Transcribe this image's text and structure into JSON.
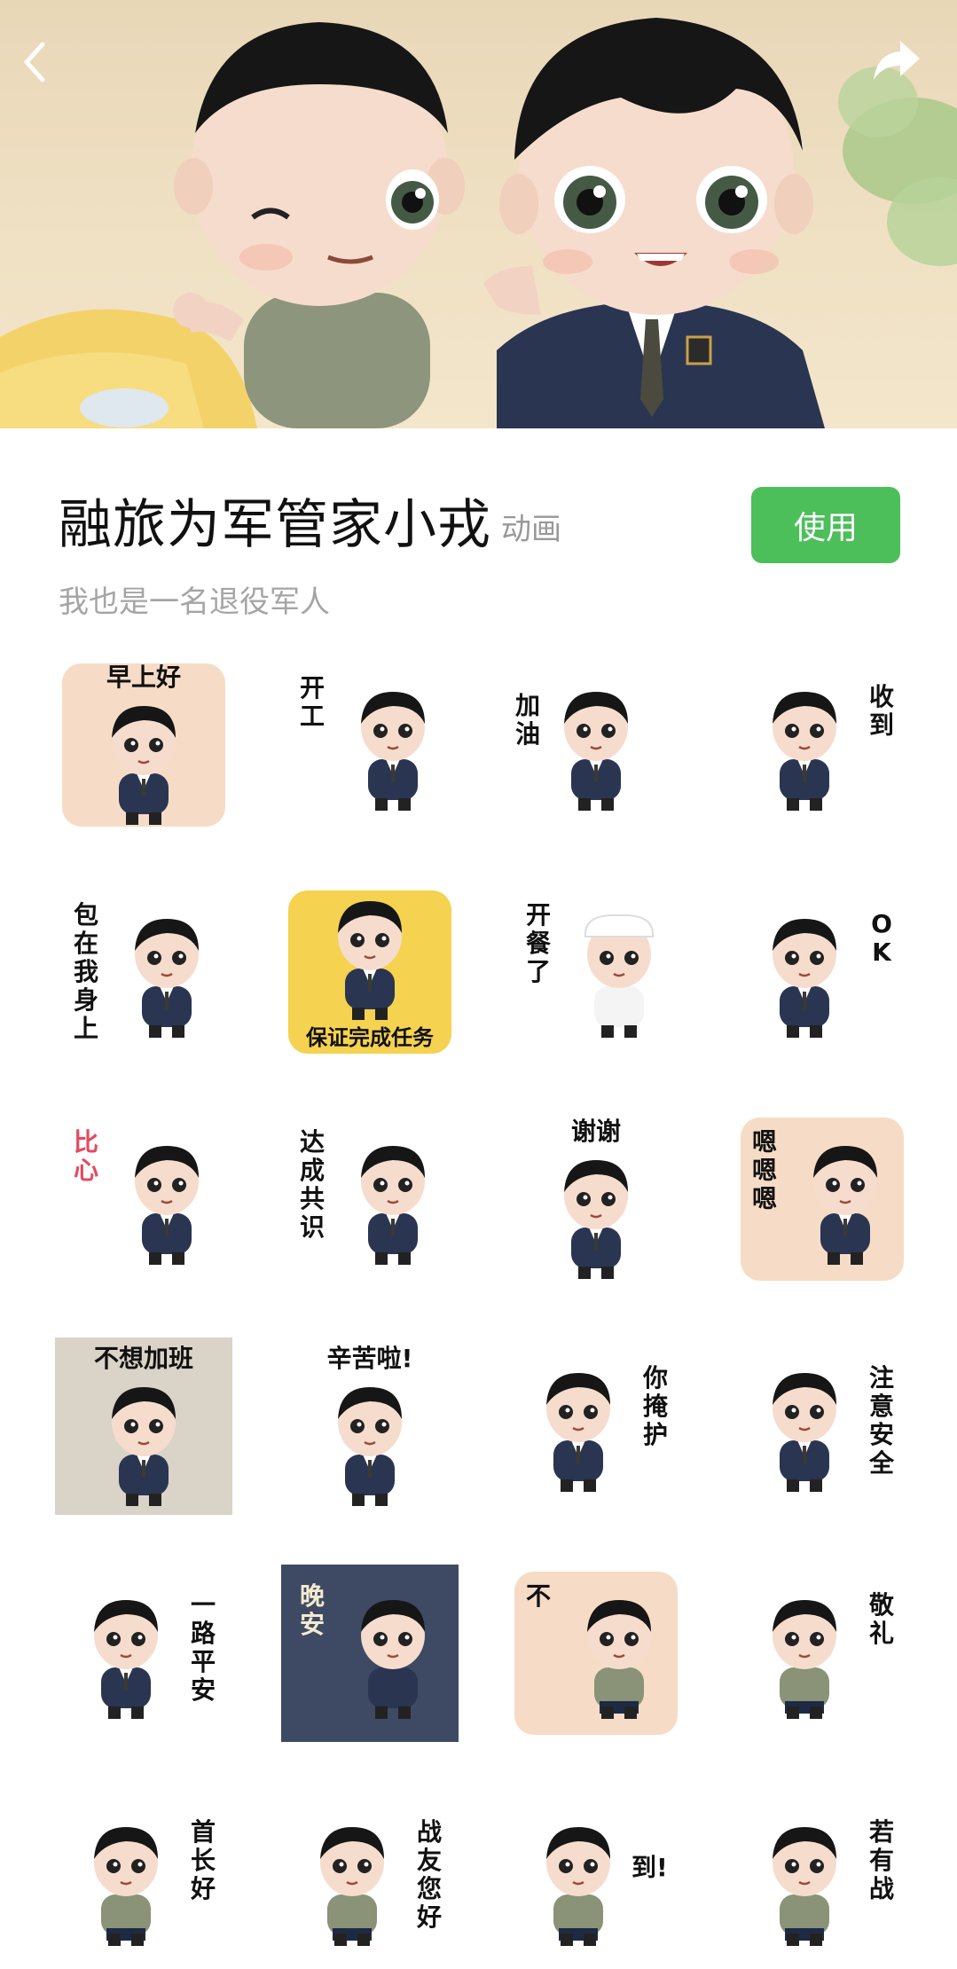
{
  "header": {
    "back_icon": "back-chevron-icon",
    "share_icon": "share-forward-icon"
  },
  "pack": {
    "title": "融旅为军管家小戎",
    "tag": "动画",
    "subtitle": "我也是一名退役军人",
    "use_label": "使用"
  },
  "stickers": [
    {
      "caption": "早上好",
      "outfit": "suit",
      "bg": "peach",
      "cap": "top"
    },
    {
      "caption": "开工",
      "outfit": "suit",
      "bg": "none",
      "cap": "vleft"
    },
    {
      "caption": "加油",
      "outfit": "suit",
      "bg": "none",
      "cap": "split"
    },
    {
      "caption": "收到",
      "outfit": "suit",
      "bg": "none",
      "cap": "vright"
    },
    {
      "caption": "包在我身上",
      "outfit": "suit",
      "bg": "none",
      "cap": "vleft"
    },
    {
      "caption": "保证完成任务",
      "outfit": "suit",
      "bg": "yellow",
      "cap": "bottom"
    },
    {
      "caption": "开餐了",
      "outfit": "chef",
      "bg": "none",
      "cap": "vleft"
    },
    {
      "caption": "OK",
      "outfit": "suit",
      "bg": "none",
      "cap": "vright"
    },
    {
      "caption": "比心",
      "outfit": "suit",
      "bg": "none",
      "cap": "vleft-red"
    },
    {
      "caption": "达成共识",
      "outfit": "suit",
      "bg": "none",
      "cap": "vleft"
    },
    {
      "caption": "谢谢",
      "outfit": "suit",
      "bg": "none",
      "cap": "top"
    },
    {
      "caption": "嗯嗯嗯",
      "outfit": "suit",
      "bg": "peach",
      "cap": "vleft"
    },
    {
      "caption": "不想加班",
      "outfit": "suit",
      "bg": "office",
      "cap": "top"
    },
    {
      "caption": "辛苦啦!",
      "outfit": "suit",
      "bg": "none",
      "cap": "top"
    },
    {
      "caption": "你掩护",
      "outfit": "suit",
      "bg": "none",
      "cap": "vright"
    },
    {
      "caption": "注意安全",
      "outfit": "suit",
      "bg": "none",
      "cap": "vright"
    },
    {
      "caption": "一路平安",
      "outfit": "suit",
      "bg": "none",
      "cap": "vright"
    },
    {
      "caption": "晚安",
      "outfit": "sleep",
      "bg": "night",
      "cap": "vleft-light"
    },
    {
      "caption": "不",
      "outfit": "tshirt",
      "bg": "peach",
      "cap": "vleft"
    },
    {
      "caption": "敬礼",
      "outfit": "tshirt",
      "bg": "none",
      "cap": "vright"
    },
    {
      "caption": "首长好",
      "outfit": "tshirt",
      "bg": "none",
      "cap": "vright"
    },
    {
      "caption": "战友您好",
      "outfit": "tshirt",
      "bg": "none",
      "cap": "vright"
    },
    {
      "caption": "到!",
      "outfit": "tshirt",
      "bg": "none",
      "cap": "right"
    },
    {
      "caption": "若有战",
      "outfit": "tshirt",
      "bg": "none",
      "cap": "vright"
    }
  ],
  "colors": {
    "accent_green": "#4cbf5b",
    "suit_navy": "#2a3552",
    "tshirt_gray": "#8a9378",
    "hair": "#161616",
    "skin": "#f6dccd"
  }
}
